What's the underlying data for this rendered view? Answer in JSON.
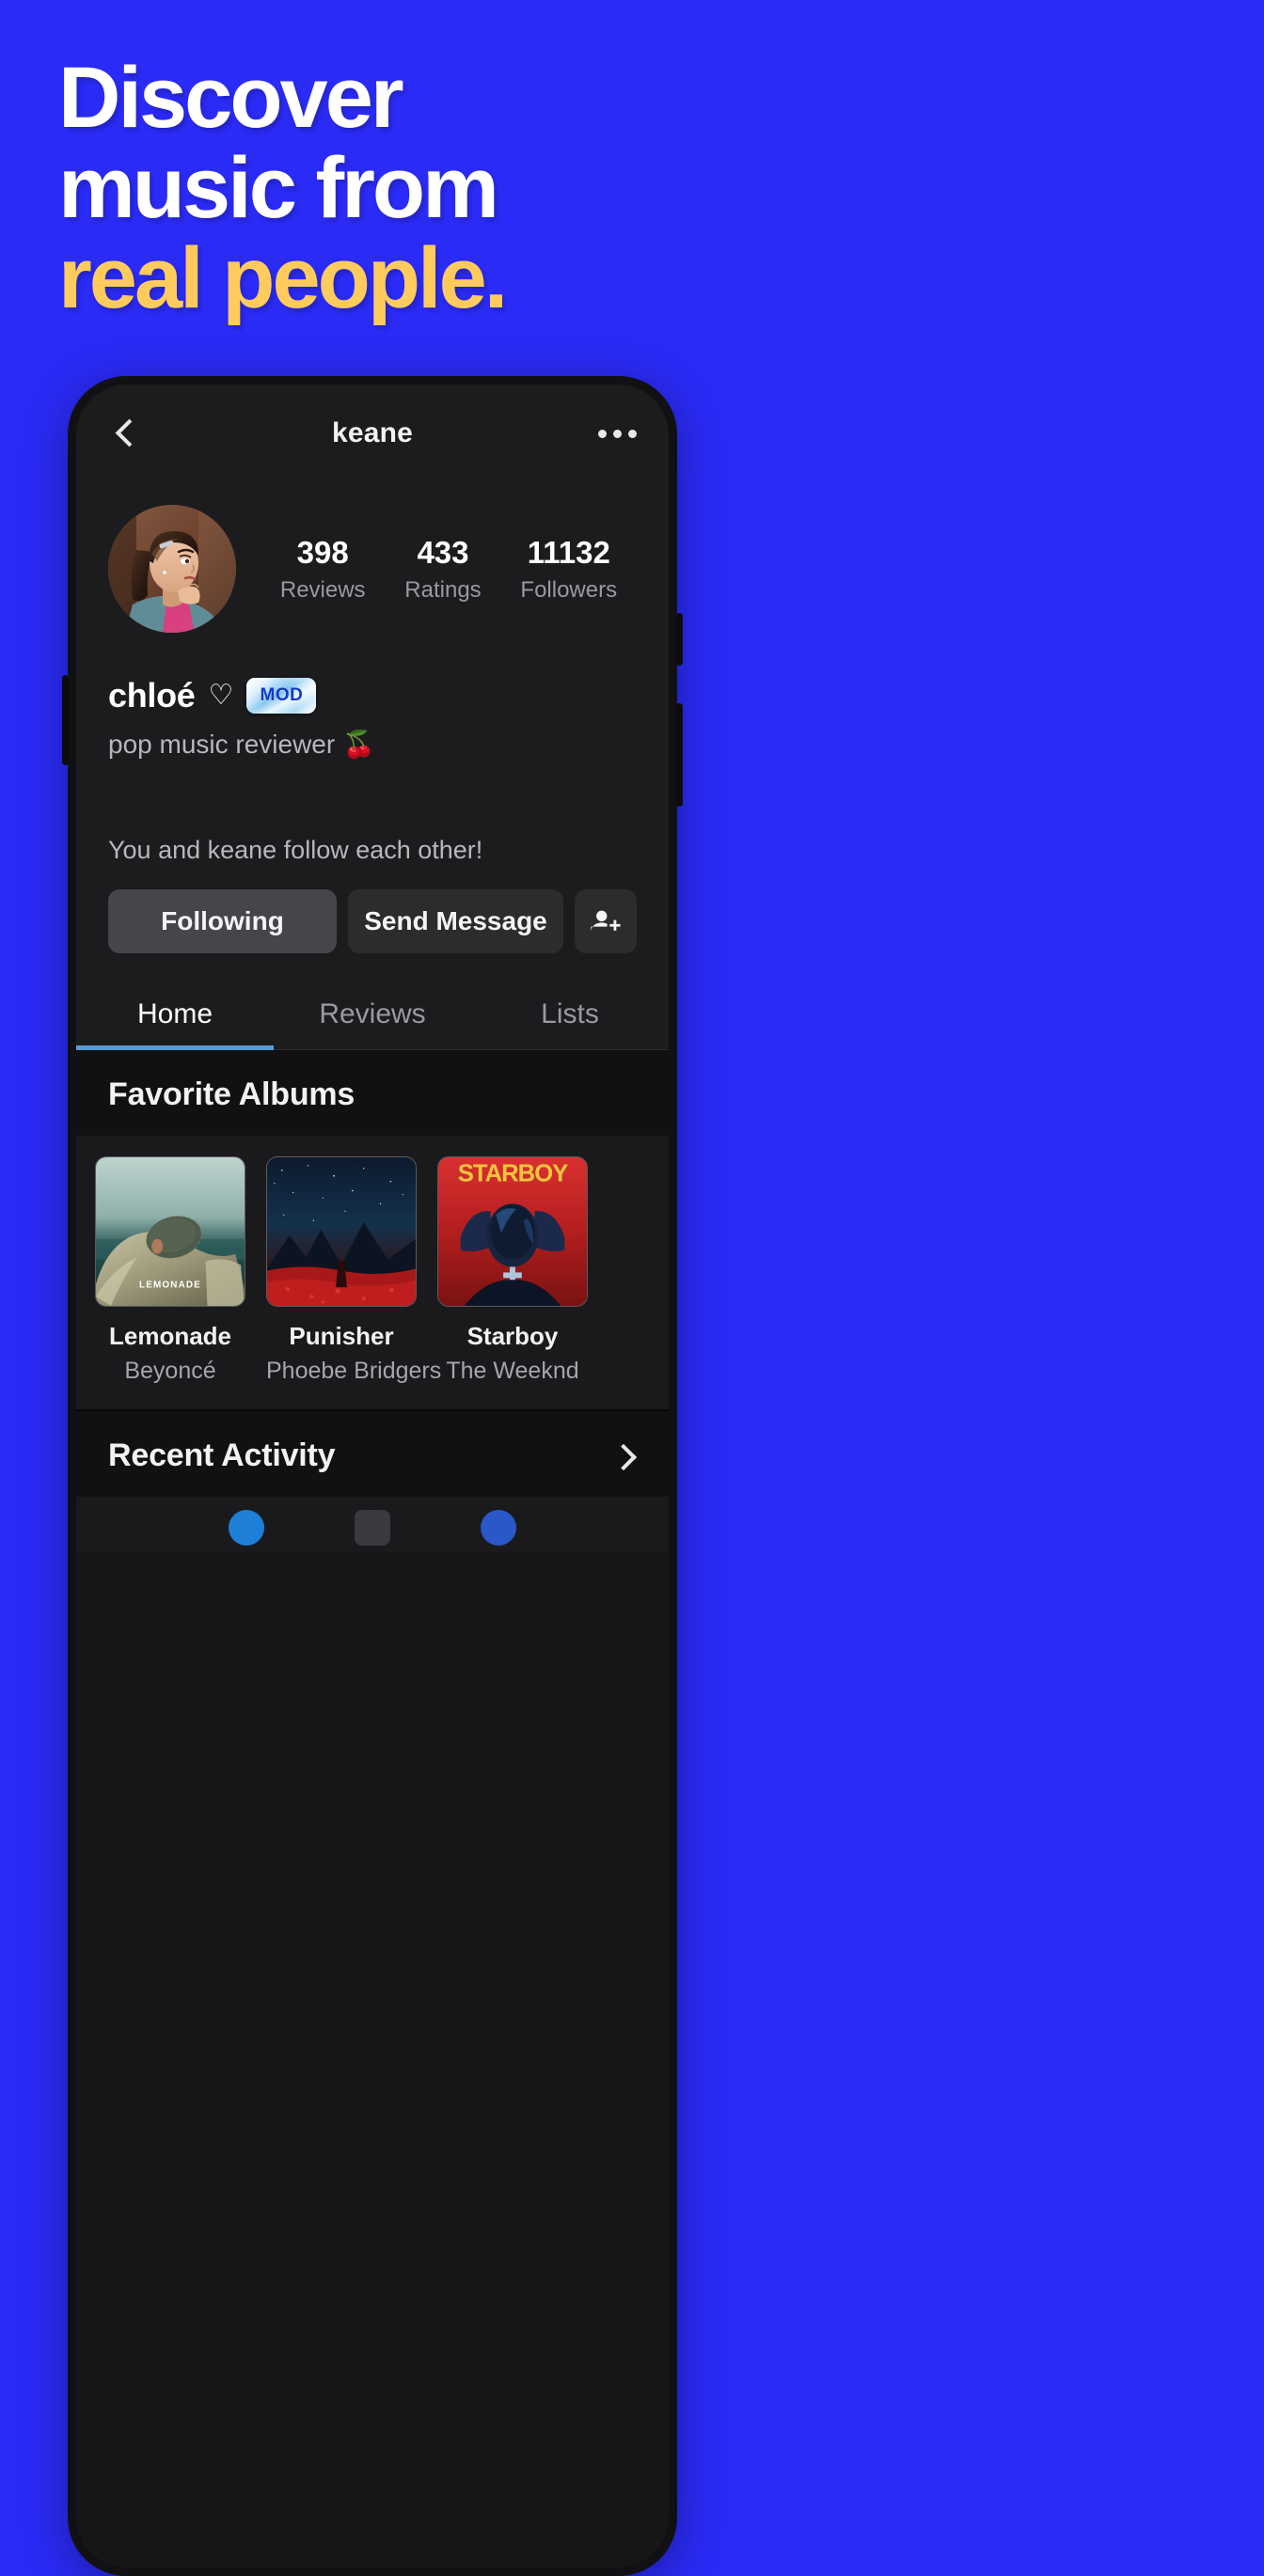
{
  "marketing": {
    "headline_lines": [
      "Discover",
      "music from"
    ],
    "headline_accent": "real people.",
    "accent_color": "#FFCB5C",
    "background_color": "#2B2BF7"
  },
  "app": {
    "header": {
      "back_icon": "chevron-left-icon",
      "title": "keane",
      "menu_icon": "overflow-menu-icon"
    },
    "profile": {
      "avatar_alt": "chloé profile photo",
      "stats": [
        {
          "value": "398",
          "label": "Reviews"
        },
        {
          "value": "433",
          "label": "Ratings"
        },
        {
          "value": "11132",
          "label": "Followers"
        }
      ],
      "display_name": "chloé",
      "heart_glyph": "♡",
      "badge_label": "MOD",
      "bio": "pop music reviewer 🍒",
      "mutual_text": "You and keane follow each other!",
      "actions": {
        "following_label": "Following",
        "message_label": "Send Message",
        "add_user_icon": "add-person-icon"
      }
    },
    "tabs": [
      {
        "label": "Home",
        "active": true
      },
      {
        "label": "Reviews",
        "active": false
      },
      {
        "label": "Lists",
        "active": false
      }
    ],
    "tab_indicator_color": "#5B9BD5",
    "sections": {
      "favorite_albums_title": "Favorite Albums",
      "recent_activity_title": "Recent Activity",
      "recent_activity_chevron": "chevron-right-icon"
    },
    "albums": [
      {
        "title": "Lemonade",
        "artist": "Beyoncé",
        "cover_text": "LEMONADE"
      },
      {
        "title": "Punisher",
        "artist": "Phoebe Bridgers",
        "cover_text": ""
      },
      {
        "title": "Starboy",
        "artist": "The Weeknd",
        "cover_text": "STARBOY"
      }
    ]
  }
}
